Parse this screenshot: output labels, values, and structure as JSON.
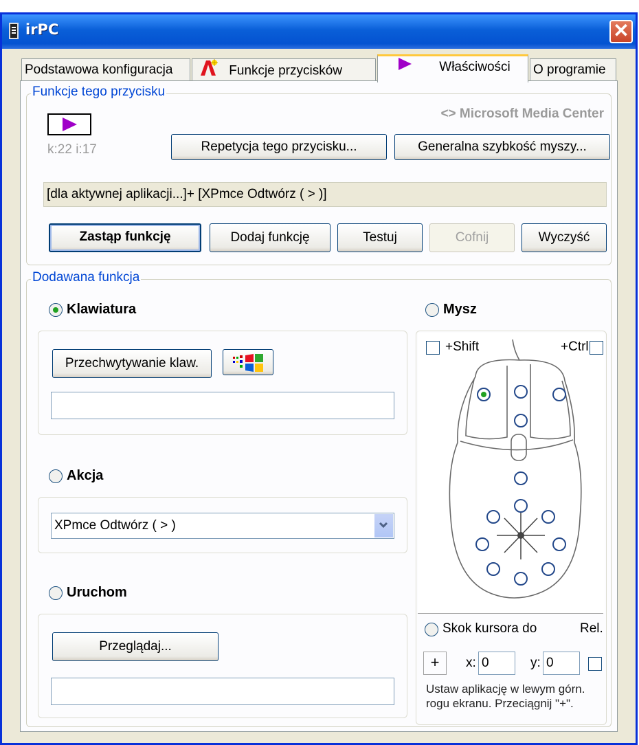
{
  "window": {
    "title": "irPC"
  },
  "tabs": [
    {
      "label": "Podstawowa konfiguracja"
    },
    {
      "label": "Funkcje przycisków"
    },
    {
      "label": "Właściwości"
    },
    {
      "label": "O programie"
    }
  ],
  "button_group": {
    "title": "Funkcje tego przycisku",
    "key_code": "k:22 i:17",
    "profile_link": "<> Microsoft Media Center",
    "repeat_button": "Repetycja tego przycisku...",
    "mouse_speed_button": "Generalna szybkość myszy...",
    "function_value": "[dla aktywnej aplikacji...]+ [XPmce  Odtwórz ( > )]",
    "replace_button": "Zastąp funkcję",
    "add_button": "Dodaj funkcję",
    "test_button": "Testuj",
    "undo_button": "Cofnij",
    "clear_button": "Wyczyść"
  },
  "added_group": {
    "title": "Dodawana funkcja",
    "keyboard": {
      "label": "Klawiatura",
      "checked": true,
      "capture_button": "Przechwytywanie klaw.",
      "value": ""
    },
    "action": {
      "label": "Akcja",
      "checked": false,
      "selected": "XPmce  Odtwórz ( > )"
    },
    "run": {
      "label": "Uruchom",
      "checked": false,
      "browse_button": "Przeglądaj...",
      "value": ""
    },
    "mouse": {
      "label": "Mysz",
      "checked": false,
      "shift_label": "+Shift",
      "ctrl_label": "+Ctrl",
      "jump_label": "Skok kursora do",
      "rel_label": "Rel.",
      "plus_label": "+",
      "x_label": "x:",
      "x_value": "0",
      "y_label": "y:",
      "y_value": "0",
      "hint": "Ustaw aplikację w lewym górn. rogu ekranu. Przeciągnij \"+\"."
    }
  },
  "colors": {
    "accent": "#0046d5",
    "title_bar": "#0a5fd8",
    "play_icon": "#a000c8",
    "radio_dot": "#21a121"
  },
  "icons": [
    "play-icon",
    "font-effects-icon",
    "windows-flag-icon",
    "dropdown-arrow-icon",
    "close-icon"
  ]
}
